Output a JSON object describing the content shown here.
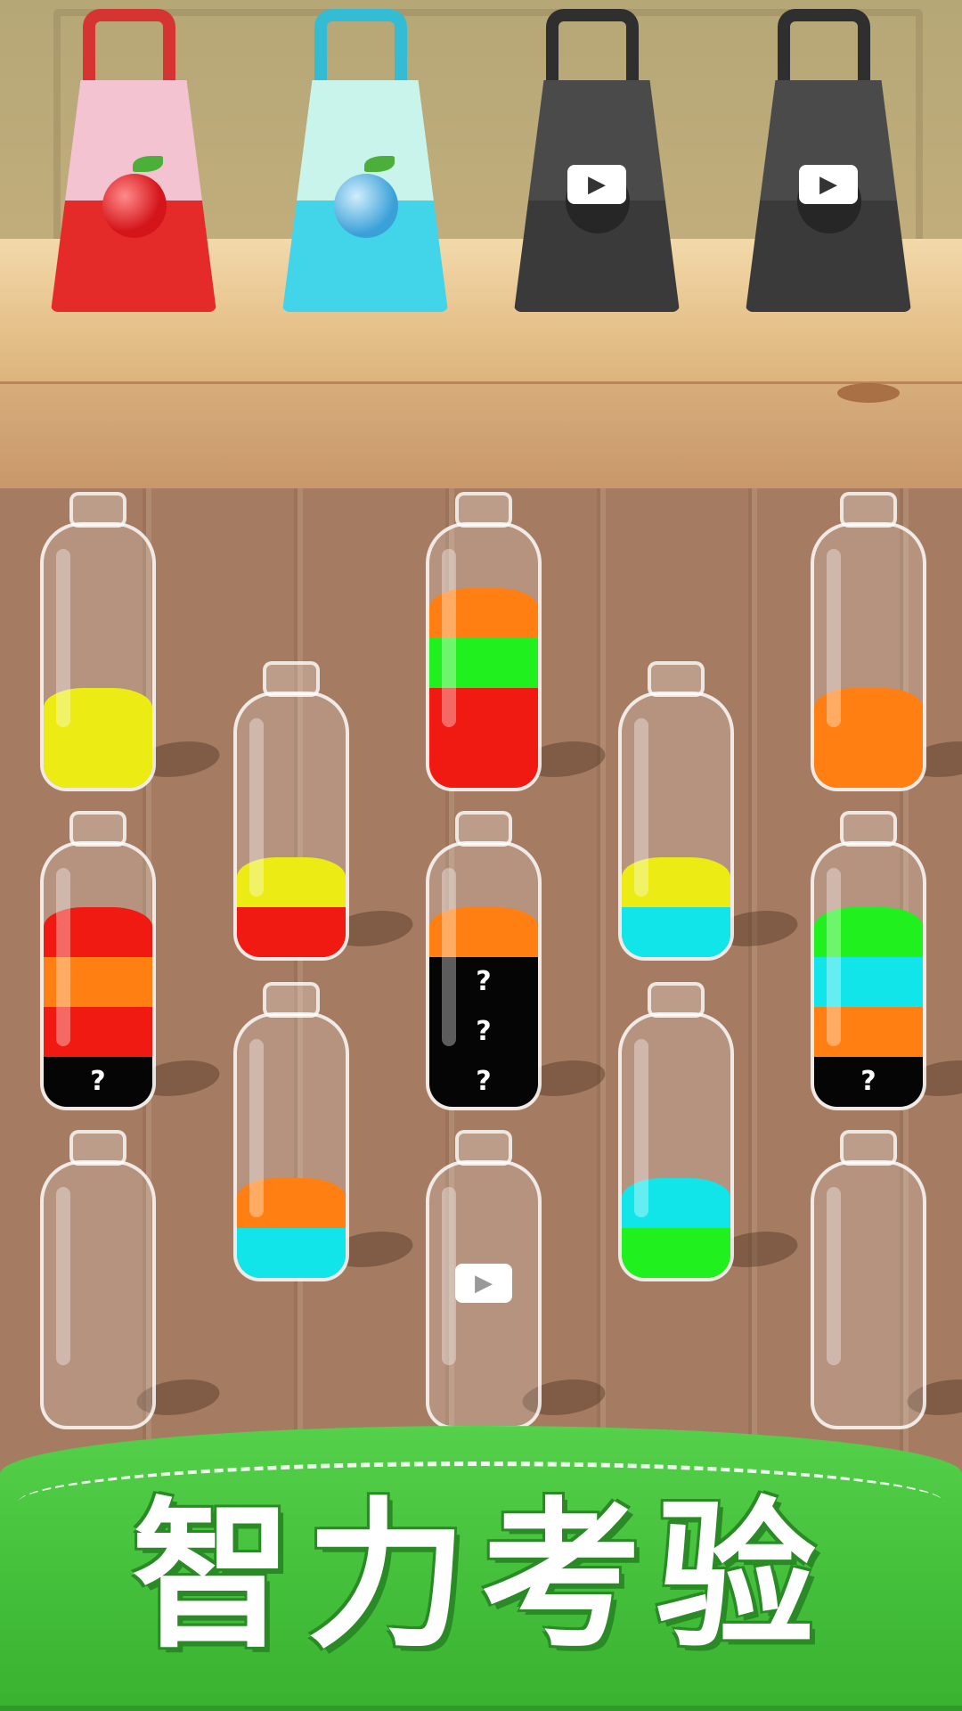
{
  "colors": {
    "red": "#f01a12",
    "orange": "#ff7f12",
    "green": "#1ff01e",
    "yellow": "#ecec14",
    "cyan": "#12e5ea",
    "black": "#050505"
  },
  "bags": [
    {
      "name": "apple-bag",
      "icon": "apple-icon",
      "body": "#f4c3d2",
      "fill": "#e52a2a",
      "handle": "#d63333",
      "locked": false
    },
    {
      "name": "blueberry-bag",
      "icon": "blueberry-icon",
      "body": "#c8f4ec",
      "fill": "#42d4e8",
      "handle": "#33bcd4",
      "locked": false
    },
    {
      "name": "locked-bag-1",
      "icon": "video-camera-icon",
      "body": "#4a4a4a",
      "fill": "#3a3a3a",
      "handle": "#2f2f2f",
      "locked": true
    },
    {
      "name": "locked-bag-2",
      "icon": "video-camera-icon",
      "body": "#4a4a4a",
      "fill": "#3a3a3a",
      "handle": "#2f2f2f",
      "locked": true
    }
  ],
  "bottles": [
    {
      "id": 1,
      "layers": [
        "yellow",
        "yellow"
      ],
      "hidden": 0,
      "locked": false
    },
    {
      "id": 2,
      "layers": [
        "red",
        "red",
        "green",
        "orange"
      ],
      "hidden": 0,
      "locked": false
    },
    {
      "id": 3,
      "layers": [
        "orange",
        "orange"
      ],
      "hidden": 0,
      "locked": false
    },
    {
      "id": 4,
      "layers": [
        "red",
        "yellow"
      ],
      "hidden": 0,
      "locked": false
    },
    {
      "id": 5,
      "layers": [
        "cyan",
        "yellow"
      ],
      "hidden": 0,
      "locked": false
    },
    {
      "id": 6,
      "layers": [
        "black",
        "red",
        "orange",
        "red"
      ],
      "hidden": 1,
      "locked": false
    },
    {
      "id": 7,
      "layers": [
        "black",
        "black",
        "black",
        "orange"
      ],
      "hidden": 3,
      "locked": false
    },
    {
      "id": 8,
      "layers": [
        "black",
        "orange",
        "cyan",
        "green"
      ],
      "hidden": 1,
      "locked": false
    },
    {
      "id": 9,
      "layers": [
        "cyan",
        "orange"
      ],
      "hidden": 0,
      "locked": false
    },
    {
      "id": 10,
      "layers": [
        "green",
        "cyan"
      ],
      "hidden": 0,
      "locked": false
    },
    {
      "id": 11,
      "layers": [],
      "hidden": 0,
      "locked": false
    },
    {
      "id": 12,
      "layers": [],
      "hidden": 0,
      "locked": true
    },
    {
      "id": 13,
      "layers": [],
      "hidden": 0,
      "locked": false
    }
  ],
  "hidden_marker": "?",
  "banner": {
    "title": "智力考验"
  }
}
